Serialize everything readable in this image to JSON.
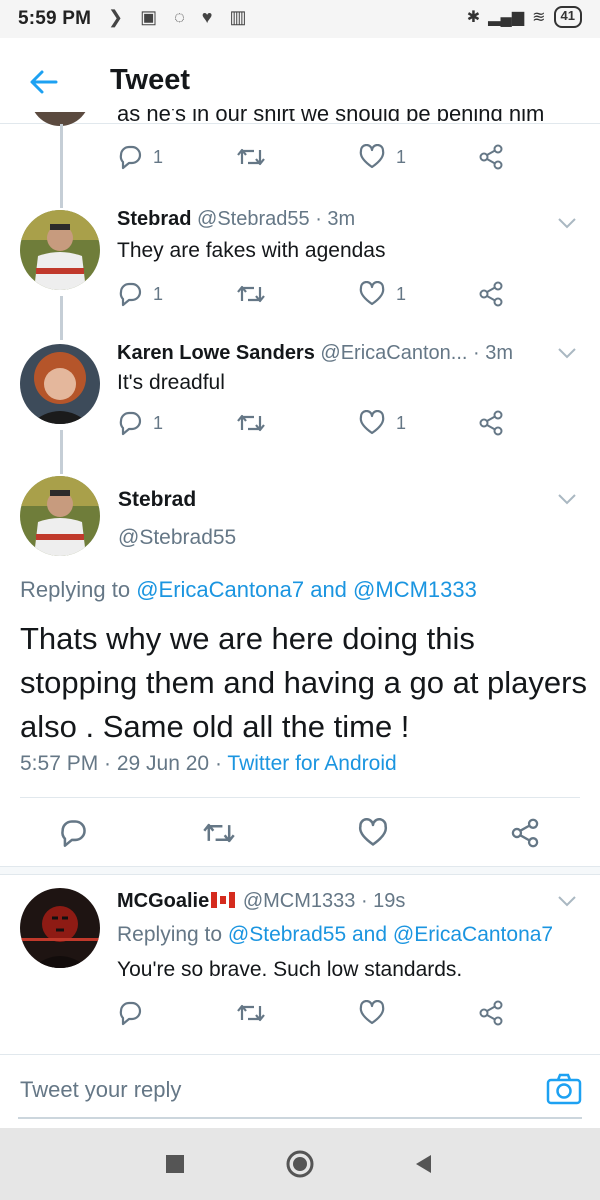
{
  "status_bar": {
    "time": "5:59 PM",
    "battery": "41"
  },
  "header": {
    "title": "Tweet"
  },
  "clipped_line": "as he's in our shirt we should be behind him",
  "tweets": [
    {
      "name": "Stebrad",
      "handle": "@Stebrad55",
      "time": "· 3m",
      "text": "They are fakes with agendas",
      "replies": "1",
      "likes": "1"
    },
    {
      "name": "Karen Lowe Sanders",
      "handle": "@EricaCanton...",
      "time": "· 3m",
      "text": "It's dreadful",
      "replies": "1",
      "likes": "1"
    }
  ],
  "top_actions": {
    "replies": "1",
    "likes": "1"
  },
  "main_tweet": {
    "name": "Stebrad",
    "handle": "@Stebrad55",
    "replying_prefix": "Replying to",
    "replying_user1": "@EricaCantona7",
    "replying_and": "and",
    "replying_user2": "@MCM1333",
    "text": "Thats why we are here doing this stopping them and having a go at players also . Same old all the time !",
    "time": "5:57 PM · 29 Jun 20 ·",
    "source": "Twitter for Android"
  },
  "reply_tweet": {
    "name": "MCGoalie",
    "handle": "@MCM1333",
    "time": "· 19s",
    "replying_prefix": "Replying to",
    "replying_user1": "@Stebrad55",
    "replying_and": "and",
    "replying_user2": "@EricaCantona7",
    "text": "You're so brave. Such low standards."
  },
  "reply_bar": {
    "placeholder": "Tweet your reply"
  },
  "colors": {
    "link": "#1b95e0",
    "secondary": "#657786",
    "primary_text": "#14171a",
    "accent": "#1da1f2"
  }
}
